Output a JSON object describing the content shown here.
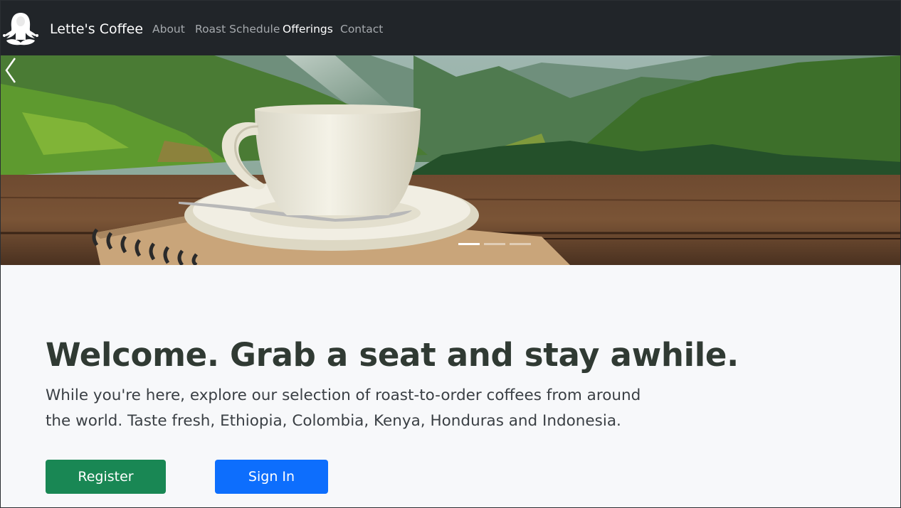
{
  "navbar": {
    "logo_icon": "meditating-woman-logo-icon",
    "brand": "Lette's Coffee",
    "links": [
      {
        "label": "About",
        "active": false
      },
      {
        "label": "Roast Schedule",
        "active": false
      },
      {
        "label": "Offerings",
        "active": true
      },
      {
        "label": "Contact",
        "active": false
      }
    ]
  },
  "carousel": {
    "image": "coffee-cup-mountains-image",
    "prev_icon": "chevron-left-icon",
    "slide_count": 3,
    "active_slide": 1
  },
  "welcome": {
    "title": "Welcome. Grab a seat and stay awhile.",
    "text": "While you're here, explore our selection of roast-to-order coffees from around the world. Taste fresh, Ethiopia, Colombia, Kenya, Honduras and Indonesia."
  },
  "buttons": {
    "register": "Register",
    "signin": "Sign In"
  },
  "colors": {
    "navbar_bg": "#212529",
    "register": "#198754",
    "signin": "#0d6efd",
    "page_bg": "#f7f8fa"
  }
}
